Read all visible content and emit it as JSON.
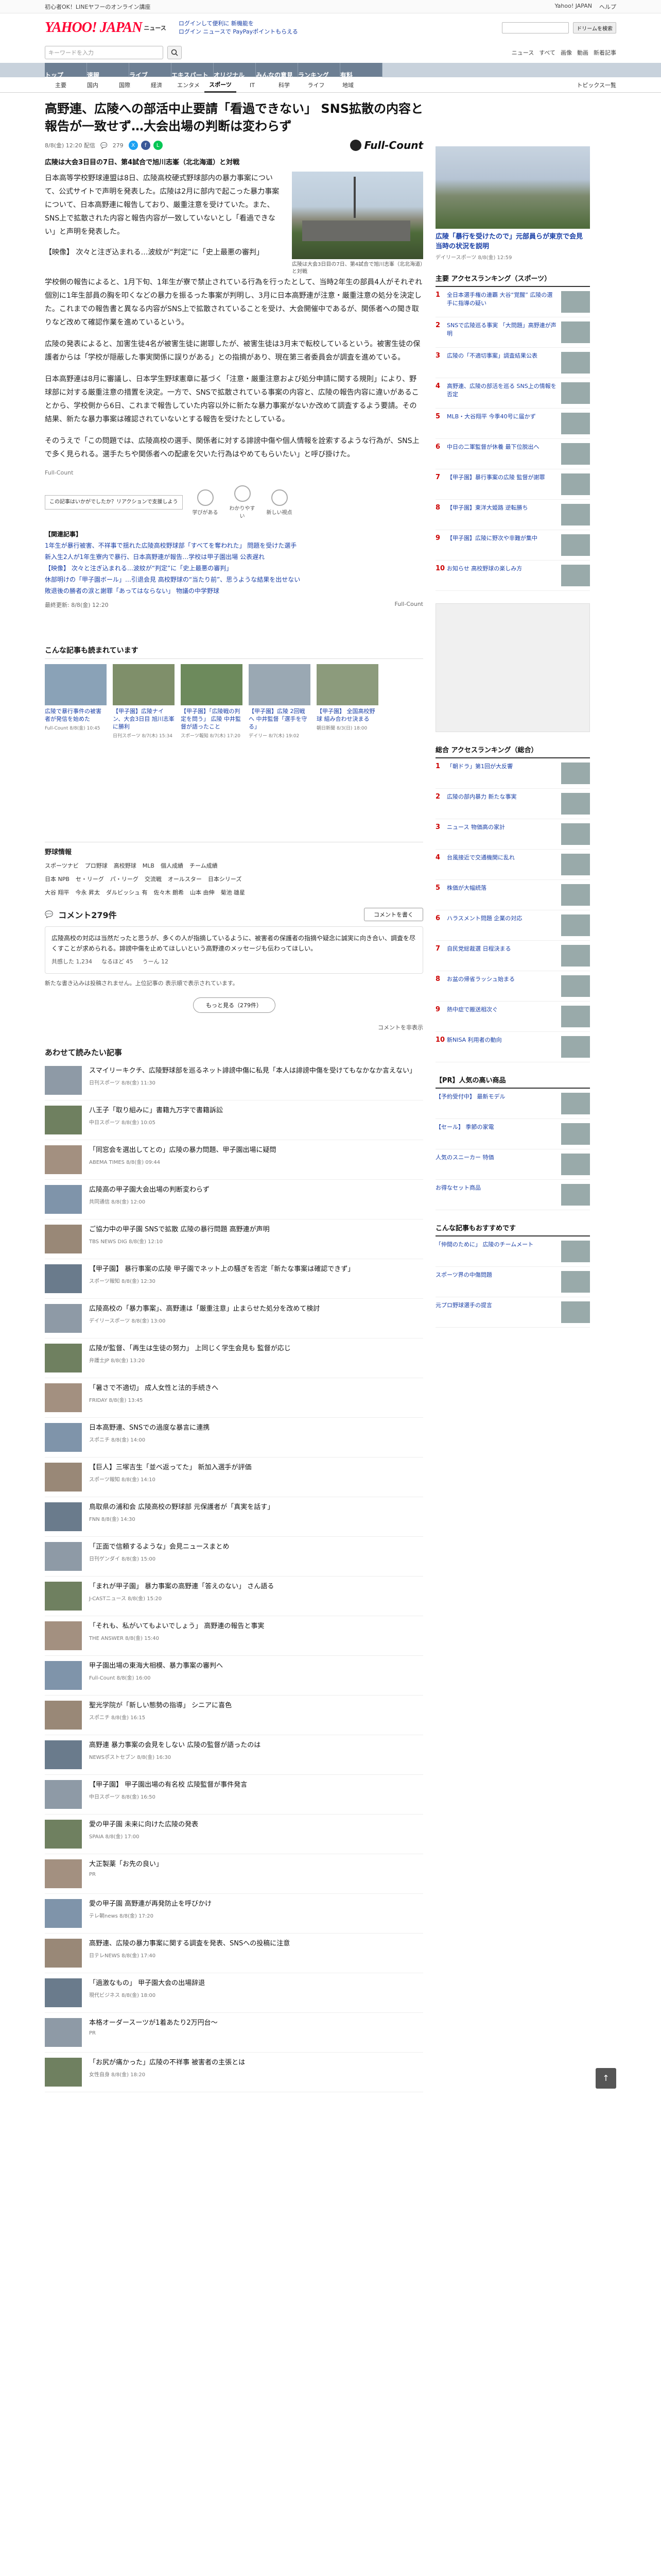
{
  "topbar": {
    "left": "初心者OK！LINEヤフーのオンライン講座",
    "links": [
      "Yahoo! JAPAN",
      "ヘルプ"
    ]
  },
  "header": {
    "logo": "YAHOO! JAPAN",
    "section": "ニュース",
    "link1": "ログインして便利に 新機能を",
    "link2": "ログイン  ニュースで PayPayポイントもらえる",
    "search_placeholder": "",
    "search_btn": "ドリームを検索",
    "user": "ログイン"
  },
  "searchrow": {
    "placeholder": "キーワードを入力",
    "opts": [
      "ニュース",
      "すべて",
      "画像",
      "動画"
    ],
    "login": "新着記事"
  },
  "nav": [
    {
      "label": "トップ",
      "active": false
    },
    {
      "label": "速報",
      "active": false
    },
    {
      "label": "ライブ",
      "active": false
    },
    {
      "label": "エキスパート",
      "active": false
    },
    {
      "label": "オリジナル",
      "active": false
    },
    {
      "label": "みんなの意見",
      "active": false
    },
    {
      "label": "ランキング",
      "active": false
    },
    {
      "label": "有料",
      "active": false
    }
  ],
  "subnav": {
    "items": [
      "主要",
      "国内",
      "国際",
      "経済",
      "エンタメ",
      "スポーツ",
      "IT",
      "科学",
      "ライフ",
      "地域"
    ],
    "active_index": 5,
    "topics": "トピックス一覧"
  },
  "article": {
    "title": "高野連、広陵への部活中止要請「看過できない」 SNS拡散の内容と報告が一致せず…大会出場の判断は変わらず",
    "meta_date": "8/8(金) 12:20 配信",
    "comments_count": "279",
    "publisher": "Full-Count",
    "lede": "広陵は大会3日目の7日、第4試合で旭川志峯（北北海道）と対戦",
    "paragraphs": [
      "日本高等学校野球連盟は8日、広陵高校硬式野球部内の暴力事案について、公式サイトで声明を発表した。広陵は2月に部内で起こった暴力事案について、日本高野連に報告しており、厳重注意を受けていた。また、SNS上で拡散された内容と報告内容が一致していないとし「看過できない」と声明を発表した。",
      "【映像】 次々と注ぎ込まれる…波紋が“判定”に「史上最悪の審判」",
      "学校側の報告によると、1月下旬、1年生が寮で禁止されている行為を行ったとして、当時2年生の部員4人がそれぞれ個別に1年生部員の胸を叩くなどの暴力を振るった事案が判明し、3月に日本高野連が注意・厳重注意の処分を決定した。これまでの報告書と異なる内容がSNS上で拡散されていることを受け、大会開催中であるが、関係者への聞き取りなど改めて確認作業を進めているという。",
      "広陵の発表によると、加害生徒4名が被害生徒に謝罪したが、被害生徒は3月末で転校しているという。被害生徒の保護者からは「学校が隠蔽した事実関係に誤りがある」との指摘があり、現在第三者委員会が調査を進めている。",
      "日本高野連は8月に審議し、日本学生野球憲章に基づく「注意・厳重注意および処分申請に関する規則」により、野球部に対する厳重注意の措置を決定。一方で、SNSで拡散されている事案の内容と、広陵の報告内容に違いがあることから、学校側から6日、これまで報告していた内容以外に新たな暴力事案がないか改めて調査するよう要請。その結果、新たな暴力事案は確認されていないとする報告を受けたとしている。",
      "そのうえで「この問題では、広陵高校の選手、関係者に対する誹謗中傷や個人情報を詮索するような行為が、SNS上で多く見られる。選手たちや関係者への配慮を欠いた行為はやめてもらいたい」と呼び掛けた。"
    ],
    "image_caption": "広陵は大会3日目の7日、第4試合で旭川志峯（北北海道）と対戦",
    "source": "Full-Count",
    "related_head": "【関連記事】",
    "related": [
      "1年生が暴行被害、不祥事で揺れた広陵高校野球部「すべてを奪われた」 問題を受けた選手",
      "新入生2人が1年生寮内で暴行、日本高野連が報告…学校は甲子園出場 公表遅れ",
      "【映像】 次々と注ぎ込まれる…波紋が“判定”に「史上最悪の審判」",
      "休部明けの「甲子園ボール」…引退会見 高校野球の“当たり前”、思うような結果を出せない",
      "敗退後の勝者の涙と謝罪「あってはならない」 物議の中学野球"
    ],
    "end_left": "最終更新: 8/8(金) 12:20",
    "end_right": "Full-Count",
    "reactions": [
      {
        "label": "学びがある",
        "count": "1"
      },
      {
        "label": "わかりやすい",
        "count": "1"
      },
      {
        "label": "新しい視点",
        "count": "0"
      }
    ],
    "tip": "この記事はいかがでしたか？リアクションで支援しよう"
  },
  "recommend": {
    "head": "こんな記事も読まれています",
    "items": [
      {
        "title": "広陵で暴行事件の被害者が発信を始めた",
        "meta": "Full-Count 8/8(金) 10:45"
      },
      {
        "title": "【甲子園】広陵ナイン、大会3日目 旭川志峯に勝利",
        "meta": "日刊スポーツ 8/7(木) 15:34"
      },
      {
        "title": "【甲子園】「広陵戦の判定を問う」 広陵 中井監督が語ったこと",
        "meta": "スポーツ報知 8/7(木) 17:20"
      },
      {
        "title": "【甲子園】広陵 2回戦へ 中井監督「選手を守る」",
        "meta": "デイリー 8/7(木) 19:02"
      },
      {
        "title": "【甲子園】 全国高校野球 組み合わせ決まる",
        "meta": "朝日新聞 8/3(日) 18:00"
      }
    ]
  },
  "baseball": {
    "title": "野球情報",
    "tabs": [
      "スポーツナビ",
      "プロ野球",
      "高校野球",
      "MLB",
      "個人成績",
      "チーム成績"
    ],
    "row2": [
      "日本 NPB",
      "セ・リーグ",
      "パ・リーグ",
      "交流戦",
      "オールスター",
      "日本シリーズ"
    ],
    "row3": [
      "大谷 翔平",
      "今永 昇太",
      "ダルビッシュ 有",
      "佐々木 朗希",
      "山本 由伸",
      "菊池 雄星"
    ]
  },
  "comments": {
    "title": "コメント279件",
    "post_btn": "コメントを書く",
    "body": "広陵高校の対応は当然だったと思うが、多くの人が指摘しているように、被害者の保護者の指摘や疑念に誠実に向き合い、調査を尽くすことが求められる。誹謗中傷を止めてほしいという高野連のメッセージも伝わってほしい。",
    "likes": "共感した 1,234",
    "thinks": "なるほど 45",
    "thoughtful": "うーん 12",
    "note": "新たな書き込みは投稿されません。上位記事の 表示順で表示されています。",
    "more": "もっと見る（279件）",
    "checkbox": "コメントを非表示"
  },
  "moreList": {
    "head": "あわせて読みたい記事",
    "items": [
      {
        "title": "スマイリーキクチ、広陵野球部を巡るネット誹謗中傷に私見「本人は誹謗中傷を受けてもなかなか言えない」",
        "meta": "日刊スポーツ 8/8(金) 11:30"
      },
      {
        "title": "八王子「取り組みに」書籍九万字で書籍訴訟",
        "meta": "中日スポーツ 8/8(金) 10:05"
      },
      {
        "title": "「同窓会を選出してとの」広陵の暴力問題、甲子園出場に疑問",
        "meta": "ABEMA TIMES 8/8(金) 09:44"
      },
      {
        "title": "広陵高の甲子園大会出場の判断変わらず",
        "meta": "共同通信 8/8(金) 12:00"
      },
      {
        "title": "ご協力中の甲子園 SNSで拡散 広陵の暴行問題 高野連が声明",
        "meta": "TBS NEWS DIG 8/8(金) 12:10"
      },
      {
        "title": "【甲子園】 暴行事案の広陵 甲子園でネット上の騒ぎを否定「新たな事案は確認できず」",
        "meta": "スポーツ報知 8/8(金) 12:30"
      },
      {
        "title": "広陵高校の「暴力事案」、高野連は「厳重注意」止まらせた処分を改めて検討",
        "meta": "デイリースポーツ 8/8(金) 13:00"
      },
      {
        "title": "広陵が監督、「再生は生徒の努力」 上同じく学生会見も 監督が応じ",
        "meta": "弁護士JP 8/8(金) 13:20"
      },
      {
        "title": "「暑さで不適切」 成人女性と法的手続きへ",
        "meta": "FRIDAY 8/8(金) 13:45"
      },
      {
        "title": "日本高野連、SNSでの過度な暴言に連携",
        "meta": "スポニチ 8/8(金) 14:00"
      },
      {
        "title": "【巨人】三塚吉生「並べ返ってた」 新加入選手が評価",
        "meta": "スポーツ報知 8/8(金) 14:10"
      },
      {
        "title": "鳥取県の浦和会 広陵高校の野球部 元保護者が「真実を話す」",
        "meta": "FNN 8/8(金) 14:30"
      },
      {
        "title": "「正面で信頼するような」会見ニュースまとめ",
        "meta": "日刊ゲンダイ 8/8(金) 15:00"
      },
      {
        "title": "「まれが甲子園」 暴力事案の高野連「答えのない」 さん語る",
        "meta": "J-CASTニュース 8/8(金) 15:20"
      },
      {
        "title": "「それも、私がいてもよいでしょう」 高野連の報告と事実",
        "meta": "THE ANSWER 8/8(金) 15:40"
      },
      {
        "title": "甲子園出場の東海大相模、暴力事案の審判へ",
        "meta": "Full-Count 8/8(金) 16:00"
      },
      {
        "title": "聖光学院が「新しい態勢の指導」 シニアに喜色",
        "meta": "スポニチ 8/8(金) 16:15"
      },
      {
        "title": "高野連 暴力事案の会見をしない 広陵の監督が語ったのは",
        "meta": "NEWSポストセブン 8/8(金) 16:30"
      },
      {
        "title": "【甲子園】 甲子園出場の有名校 広陵監督が事件発言",
        "meta": "中日スポーツ 8/8(金) 16:50"
      },
      {
        "title": "愛の甲子園 未来に向けた広陵の発表",
        "meta": "SPAIA 8/8(金) 17:00"
      },
      {
        "title": "大正製薬「お先の良い」",
        "meta": "PR"
      },
      {
        "title": "愛の甲子園 高野連が再発防止を呼びかけ",
        "meta": "テレ朝news 8/8(金) 17:20"
      },
      {
        "title": "高野連、広陵の暴力事案に関する調査を発表、SNSへの投稿に注意",
        "meta": "日テレNEWS 8/8(金) 17:40"
      },
      {
        "title": "「過激なもの」 甲子園大会の出場辞退",
        "meta": "現代ビジネス 8/8(金) 18:00"
      },
      {
        "title": "本格オーダースーツが1着あたり2万円台〜",
        "meta": "PR"
      },
      {
        "title": "「お尻が痛かった」広陵の不祥事 被害者の主張とは",
        "meta": "女性自身 8/8(金) 18:20"
      }
    ]
  },
  "right": {
    "hero_headline": "広陵「暴行を受けたので」元部員らが東京で会見　当時の状況を説明",
    "hero_meta": "デイリースポーツ 8/8(金) 12:59",
    "ranking_head": "主要 アクセスランキング（スポーツ）",
    "ranking": [
      "全日本選手権の連覇 大谷“覚醒” 広陵の選手に指導の疑い",
      "SNSで広陵巡る事実 「大問題」高野連が声明",
      "広陵の「不適切事案」調査結果公表",
      "高野連、広陵の部活を巡る SNS上の情報を否定",
      "MLB・大谷翔平 今季40号に届かず",
      "中日の二軍監督が休養 最下位脱出へ",
      "【甲子園】暴行事案の広陵 監督が謝罪",
      "【甲子園】東洋大姫路 逆転勝ち",
      "【甲子園】広陵に野次や非難が集中",
      "お知らせ 高校野球の楽しみ方"
    ],
    "ranking2_head": "総合 アクセスランキング（総合）",
    "ranking2": [
      "「朝ドラ」第1回が大反響",
      "広陵の部内暴力 新たな事実",
      "ニュース 物価高の家計",
      "台風接近で交通機関に乱れ",
      "株価が大幅続落",
      "ハラスメント問題 企業の対応",
      "自民党総裁選 日程決まる",
      "お盆の帰省ラッシュ始まる",
      "熱中症で搬送相次ぐ",
      "新NISA 利用者の動向"
    ],
    "paypay_head": "【PR】人気の高い商品",
    "paypay": [
      "【予約受付中】 最新モデル",
      "【セール】 季節の家電",
      "人気のスニーカー 特価",
      "お得なセット商品"
    ],
    "recommend_head": "こんな記事もおすすめです",
    "recommend": [
      "「仲間のために」 広陵のチームメート",
      "スポーツ界の中傷問題",
      "元プロ野球選手の提言"
    ]
  },
  "pagetop": "↑"
}
